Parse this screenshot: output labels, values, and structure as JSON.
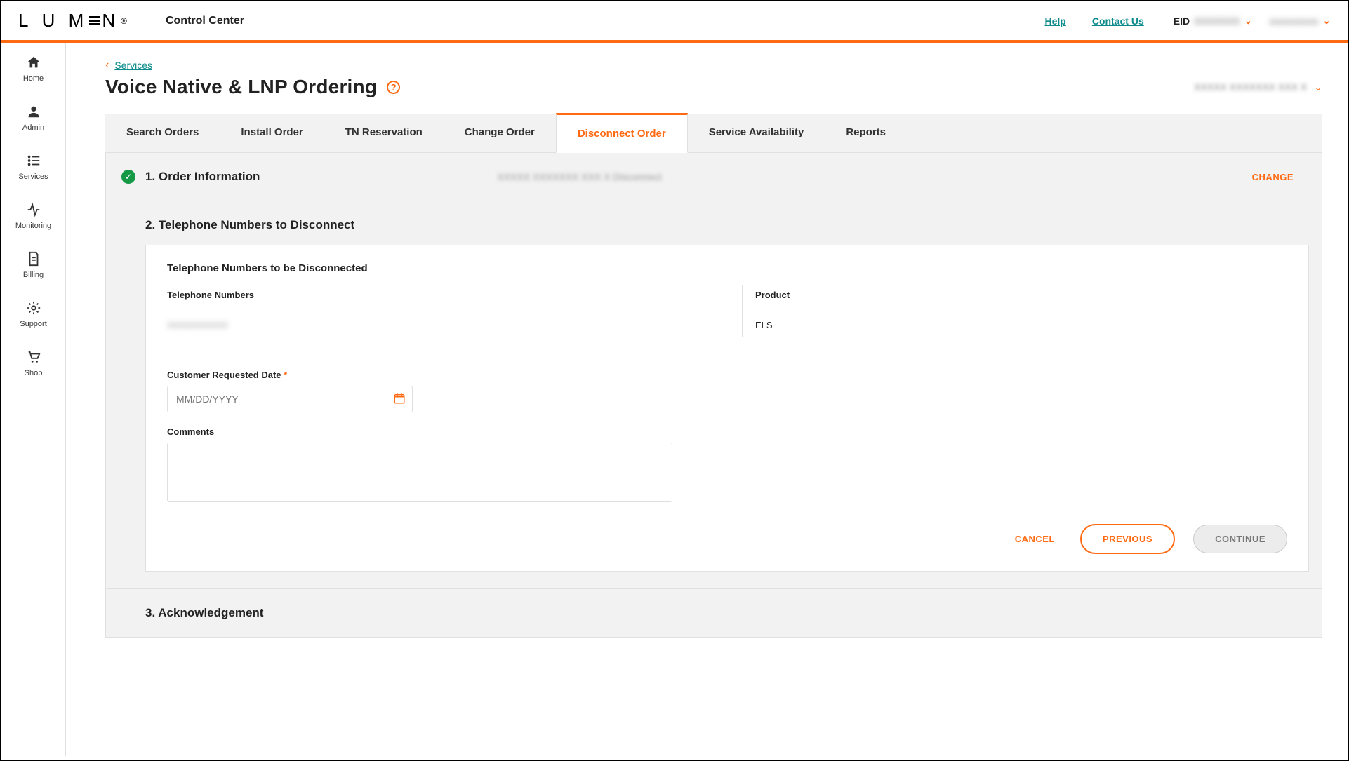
{
  "header": {
    "brand": "LUMEN",
    "app_title": "Control Center",
    "help": "Help",
    "contact": "Contact Us",
    "eid_label": "EID",
    "eid_value": "XXXXXXX",
    "user_value": "xxxxxxxxx"
  },
  "sidenav": {
    "home": "Home",
    "admin": "Admin",
    "services": "Services",
    "monitoring": "Monitoring",
    "billing": "Billing",
    "support": "Support",
    "shop": "Shop"
  },
  "breadcrumb": {
    "back": "Services"
  },
  "page": {
    "title": "Voice Native & LNP Ordering",
    "context_value": "XXXXX XXXXXXX XXX X"
  },
  "tabs": {
    "search": "Search Orders",
    "install": "Install Order",
    "tn": "TN Reservation",
    "change": "Change Order",
    "disconnect": "Disconnect Order",
    "availability": "Service Availability",
    "reports": "Reports"
  },
  "sections": {
    "s1_title": "1. Order Information",
    "s1_context": "XXXXX XXXXXXX XXX X  Disconnect",
    "change_btn": "CHANGE",
    "s2_title": "2. Telephone Numbers to Disconnect",
    "s3_title": "3. Acknowledgement"
  },
  "card": {
    "title": "Telephone Numbers to be Disconnected",
    "col_tn": "Telephone Numbers",
    "col_product": "Product",
    "row_tn": "XXXXXXXXXX",
    "row_product": "ELS",
    "date_label": "Customer Requested Date",
    "date_placeholder": "MM/DD/YYYY",
    "comments_label": "Comments",
    "cancel": "CANCEL",
    "previous": "PREVIOUS",
    "continue": "CONTINUE"
  }
}
